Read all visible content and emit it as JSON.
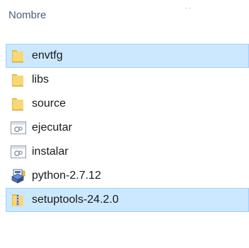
{
  "header": {
    "name_column": "Nombre"
  },
  "files": [
    {
      "label": "envtfg",
      "icon": "folder-icon",
      "selected": true
    },
    {
      "label": "libs",
      "icon": "folder-icon",
      "selected": false
    },
    {
      "label": "source",
      "icon": "folder-icon",
      "selected": false
    },
    {
      "label": "ejecutar",
      "icon": "batch-file-icon",
      "selected": false
    },
    {
      "label": "instalar",
      "icon": "batch-file-icon",
      "selected": false
    },
    {
      "label": "python-2.7.12",
      "icon": "installer-package-icon",
      "selected": false
    },
    {
      "label": "setuptools-24.2.0",
      "icon": "zip-folder-icon",
      "selected": true
    }
  ],
  "colors": {
    "selection_bg": "#cce8ff",
    "selection_border": "#99d1ff",
    "folder": "#f8d775",
    "header_text": "#4c607a"
  }
}
